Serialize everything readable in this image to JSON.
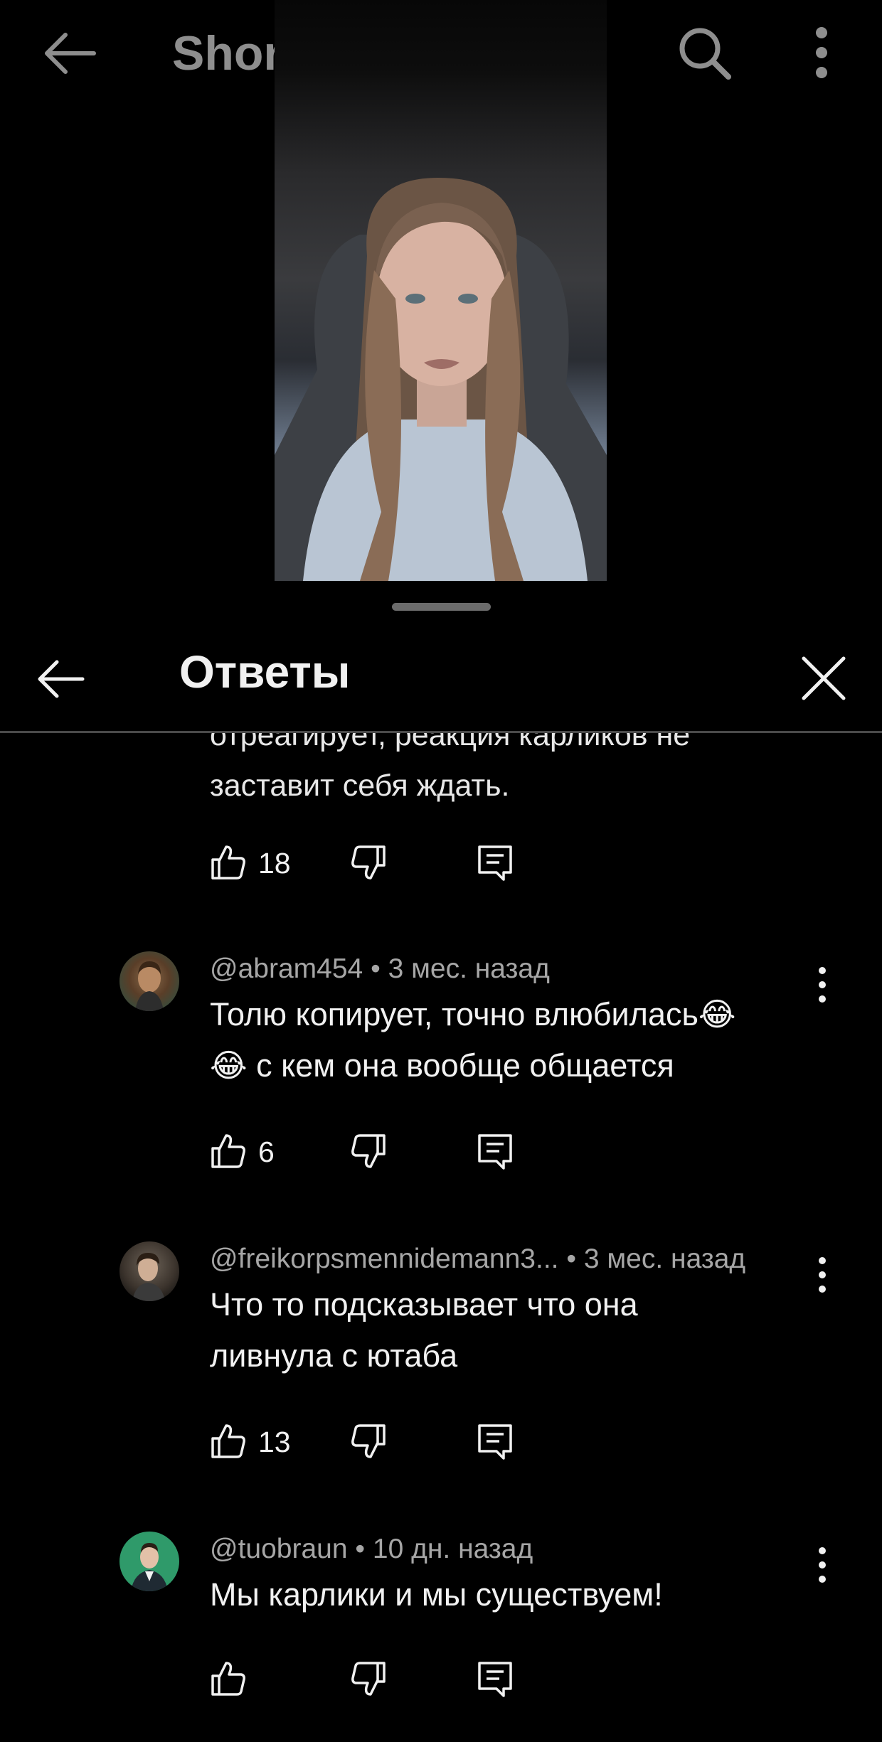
{
  "top_header": {
    "title": "Shorts"
  },
  "panel": {
    "title": "Ответы"
  },
  "comments": {
    "partial": {
      "cut_line": "отреагирует, реакция карликов не",
      "last_line": "заставит себя ждать.",
      "likes": "18"
    },
    "items": [
      {
        "author": "@abram454",
        "time": "3 мес. назад",
        "line1": "Толю копирует, точно влюбилась😂",
        "line2": "😂 с кем она вообще общается",
        "likes": "6"
      },
      {
        "author": "@freikorpsmennidemann3...",
        "time": "3 мес. назад",
        "line1": "Что то подсказывает что она",
        "line2": "ливнула с ютаба",
        "likes": "13"
      },
      {
        "author": "@tuobraun",
        "time": "10 дн. назад",
        "line1": "Мы карлики и мы существуем!",
        "line2": "",
        "likes": ""
      }
    ]
  },
  "icons": {
    "back": "arrow-left-icon",
    "search": "search-icon",
    "more": "more-vert-icon",
    "close": "close-icon",
    "like": "thumb-up-icon",
    "dislike": "thumb-down-icon",
    "reply": "comment-reply-icon"
  },
  "colors": {
    "background": "#000000",
    "text": "#f1f1f1",
    "meta": "#a6a6a6",
    "header_dim": "#8e8e8e",
    "avatar_green": "#2f9a6a"
  }
}
